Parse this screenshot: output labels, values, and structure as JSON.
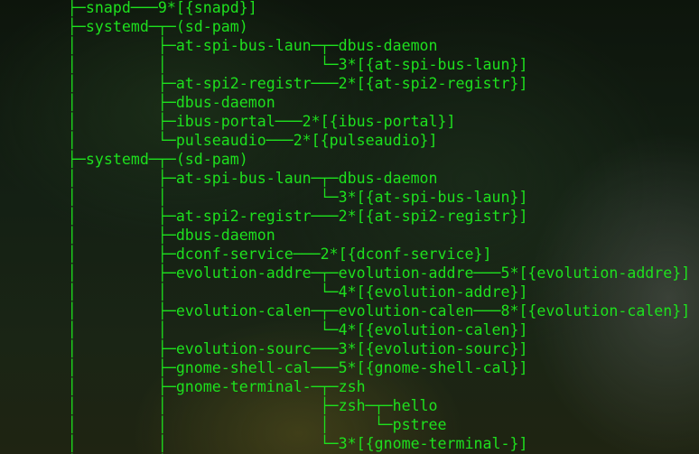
{
  "terminal": {
    "foreground": "#1ee01e",
    "lines": [
      "       ├─snapd───9*[{snapd}]",
      "       ├─systemd─┬─(sd-pam)",
      "       │         ├─at-spi-bus-laun─┬─dbus-daemon",
      "       │         │                 └─3*[{at-spi-bus-laun}]",
      "       │         ├─at-spi2-registr───2*[{at-spi2-registr}]",
      "       │         ├─dbus-daemon",
      "       │         ├─ibus-portal───2*[{ibus-portal}]",
      "       │         └─pulseaudio───2*[{pulseaudio}]",
      "       ├─systemd─┬─(sd-pam)",
      "       │         ├─at-spi-bus-laun─┬─dbus-daemon",
      "       │         │                 └─3*[{at-spi-bus-laun}]",
      "       │         ├─at-spi2-registr───2*[{at-spi2-registr}]",
      "       │         ├─dbus-daemon",
      "       │         ├─dconf-service───2*[{dconf-service}]",
      "       │         ├─evolution-addre─┬─evolution-addre───5*[{evolution-addre}]",
      "       │         │                 └─4*[{evolution-addre}]",
      "       │         ├─evolution-calen─┬─evolution-calen───8*[{evolution-calen}]",
      "       │         │                 └─4*[{evolution-calen}]",
      "       │         ├─evolution-sourc───3*[{evolution-sourc}]",
      "       │         ├─gnome-shell-cal───5*[{gnome-shell-cal}]",
      "       │         ├─gnome-terminal-─┬─zsh",
      "       │         │                 ├─zsh─┬─hello",
      "       │         │                 │     └─pstree",
      "       │         │                 └─3*[{gnome-terminal-}]",
      "       │         │"
    ]
  }
}
